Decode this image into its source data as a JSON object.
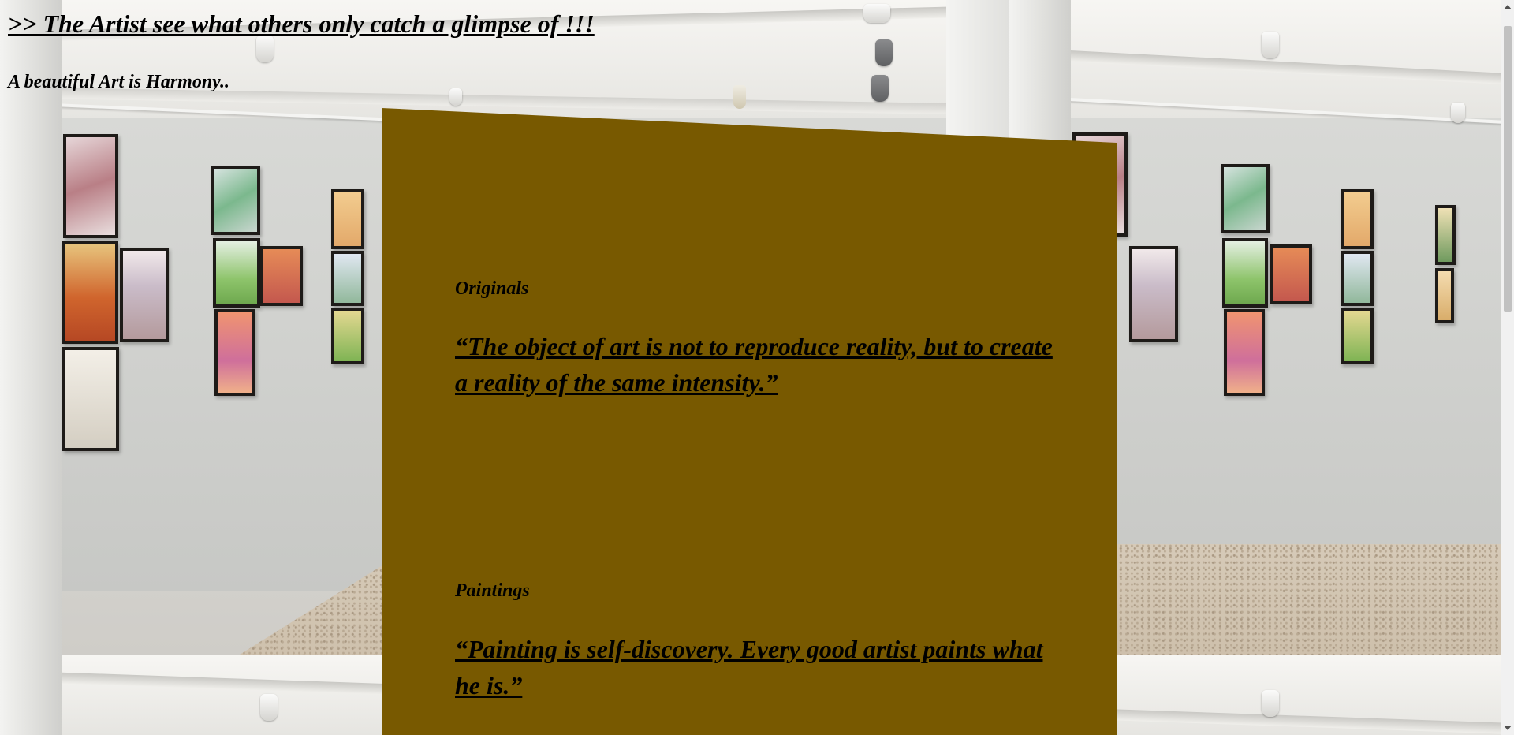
{
  "page": {
    "headline": ">> The Artist see what others only catch a glimpse of !!!",
    "tagline": "A beautiful Art is Harmony.."
  },
  "sections": [
    {
      "label": "Originals",
      "quote": "“The object of art is not to reproduce reality, but to create a reality of the same intensity.”"
    },
    {
      "label": "Paintings",
      "quote": "“Painting is self-discovery. Every good artist paints what he is.”"
    }
  ],
  "colors": {
    "panel": "#785900",
    "accent_top_line": "#b8365f",
    "text": "#000000"
  },
  "background_image": "art-gallery-photo"
}
